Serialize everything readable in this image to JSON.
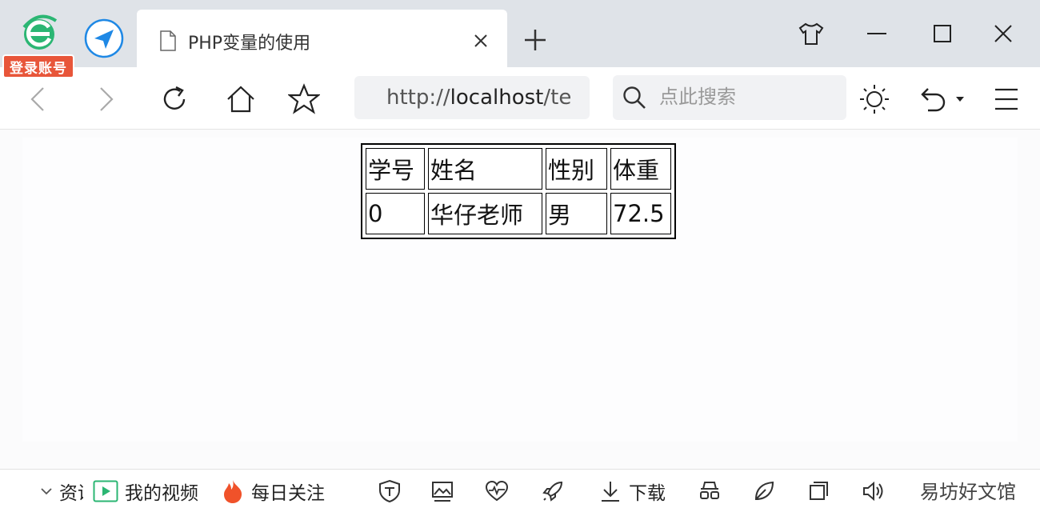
{
  "account": {
    "login_label": "登录账号"
  },
  "tab": {
    "title": "PHP变量的使用"
  },
  "toolbar": {
    "address_prefix": "http://",
    "address_host": "localhost",
    "address_rest": "/te",
    "search_placeholder": "点此搜索"
  },
  "table": {
    "headers": [
      "学号",
      "姓名",
      "性别",
      "体重"
    ],
    "rows": [
      [
        "0",
        "华仔老师",
        "男",
        "72.5"
      ]
    ]
  },
  "statusbar": {
    "item_cut": "资讯",
    "video": "我的视频",
    "daily": "每日关注",
    "download": "下载",
    "watermark": "易坊好文馆"
  },
  "colors": {
    "accent_green": "#2bb673",
    "badge_red": "#e8563a",
    "nav_blue": "#1e88e5",
    "flame": "#f0522a"
  },
  "icons": [
    "ie-logo-icon",
    "navigation-icon",
    "page-icon",
    "close-icon",
    "plus-icon",
    "skin-icon",
    "minimize-icon",
    "maximize-icon",
    "window-close-icon",
    "back-icon",
    "forward-icon",
    "refresh-icon",
    "home-icon",
    "star-icon",
    "search-icon",
    "brightness-icon",
    "undo-icon",
    "menu-icon",
    "chevron-down-icon",
    "play-icon",
    "flame-icon",
    "shield-icon",
    "image-icon",
    "heartbeat-icon",
    "rocket-icon",
    "download-icon",
    "glasses-icon",
    "leaf-icon",
    "window-icon",
    "volume-icon"
  ]
}
